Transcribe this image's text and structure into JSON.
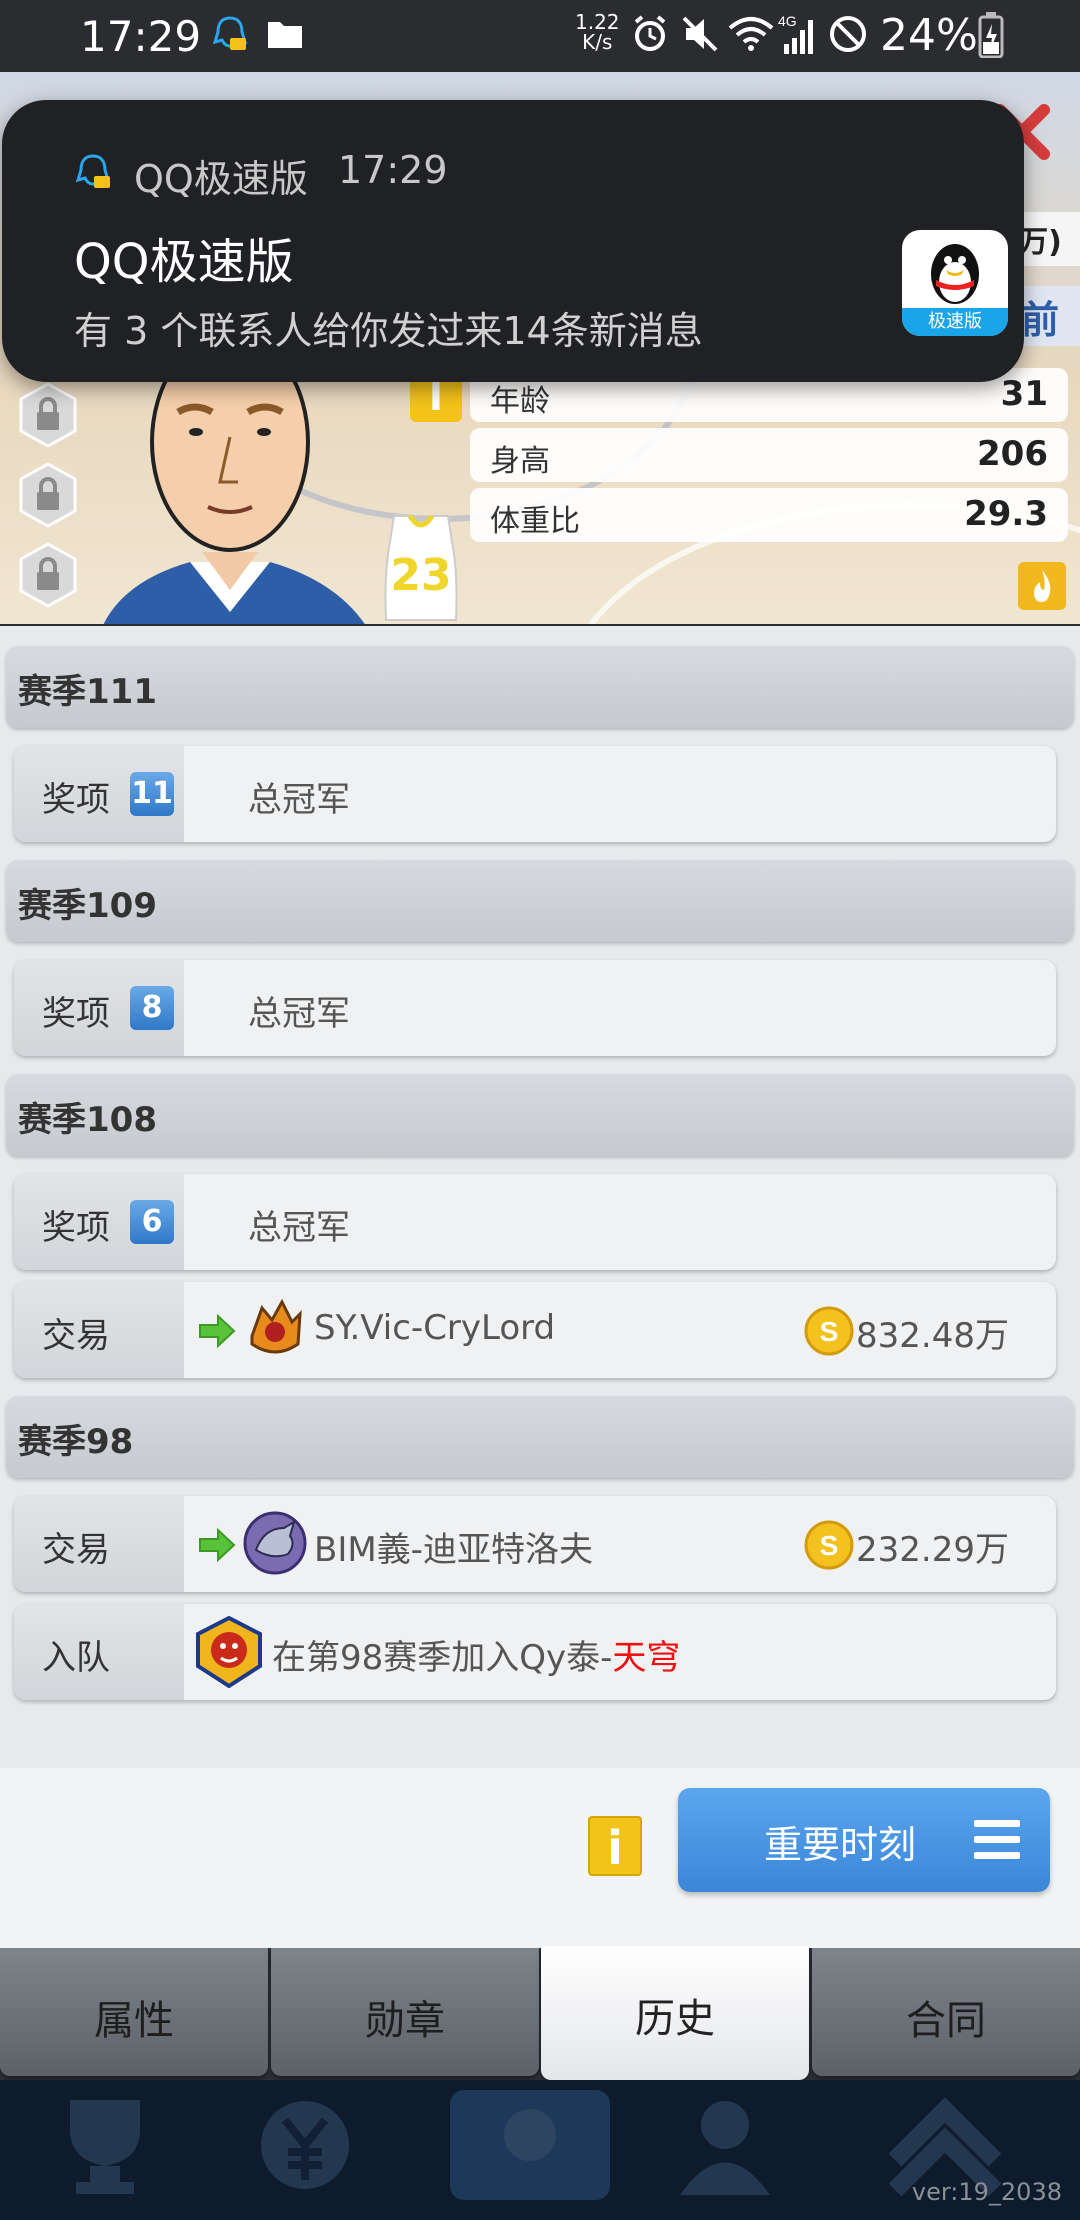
{
  "status_bar": {
    "time": "17:29",
    "net_speed_value": "1.22",
    "net_speed_unit": "K/s",
    "battery": "24%"
  },
  "notification": {
    "app_name": "QQ极速版",
    "time": "17:29",
    "title": "QQ极速版",
    "body": "有 3 个联系人给你发过来14条新消息",
    "thumb_tag": "极速版"
  },
  "player": {
    "header_right_top": "万)",
    "header_right_second": "前",
    "jersey_number": "23",
    "info_badge": "I",
    "stats": [
      {
        "label": "年龄",
        "value": "31"
      },
      {
        "label": "身高",
        "value": "206"
      },
      {
        "label": "体重比",
        "value": "29.3"
      }
    ]
  },
  "history": {
    "seasons": [
      {
        "title": "赛季111",
        "entries": [
          {
            "type": "award",
            "category": "奖项",
            "count": "11",
            "text": "总冠军"
          }
        ]
      },
      {
        "title": "赛季109",
        "entries": [
          {
            "type": "award",
            "category": "奖项",
            "count": "8",
            "text": "总冠军"
          }
        ]
      },
      {
        "title": "赛季108",
        "entries": [
          {
            "type": "award",
            "category": "奖项",
            "count": "6",
            "text": "总冠军"
          },
          {
            "type": "trade",
            "category": "交易",
            "team": "SY.Vic-CryLord",
            "amount": "832.48万"
          }
        ]
      },
      {
        "title": "赛季98",
        "entries": [
          {
            "type": "trade",
            "category": "交易",
            "team": "BIM義-迪亚特洛夫",
            "amount": "232.29万"
          },
          {
            "type": "join",
            "category": "入队",
            "text_prefix": "在第98赛季加入Qy泰-",
            "text_highlight": "天穹"
          }
        ]
      }
    ]
  },
  "action_bar": {
    "info_label": "i",
    "moments_label": "重要时刻"
  },
  "tabs": [
    {
      "label": "属性",
      "active": false
    },
    {
      "label": "勋章",
      "active": false
    },
    {
      "label": "历史",
      "active": true
    },
    {
      "label": "合同",
      "active": false
    }
  ],
  "footer": {
    "version": "ver:19_2038"
  },
  "colors": {
    "accent_blue": "#3b86d8",
    "badge_blue": "#2f78c8",
    "highlight_red": "#e11111",
    "gold": "#f1c31b"
  }
}
